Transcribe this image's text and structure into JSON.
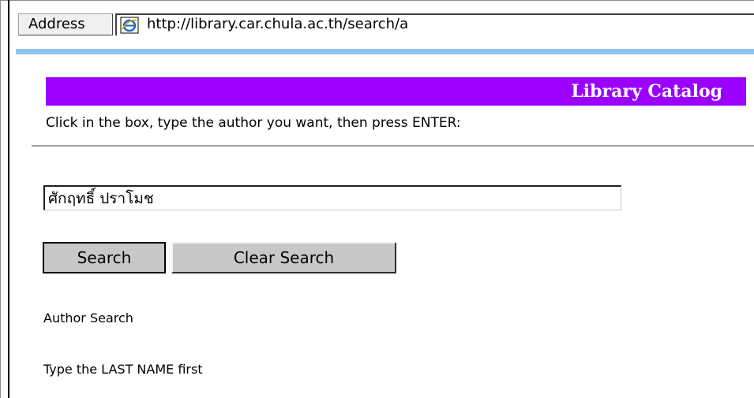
{
  "address_bar": {
    "label": "Address",
    "url": "http://library.car.chula.ac.th/search/a",
    "icon": "ie-page-icon"
  },
  "catalog": {
    "title": "Library Catalog",
    "banner_color": "#9b00ff"
  },
  "search": {
    "instruction": "Click in the box, type the author you want, then press ENTER:",
    "input_value": "ศักฤทธิ์ ปราโมช",
    "search_button_label": "Search",
    "clear_button_label": "Clear Search"
  },
  "notes": {
    "search_type": "Author Search",
    "hint": "Type the LAST NAME first"
  }
}
